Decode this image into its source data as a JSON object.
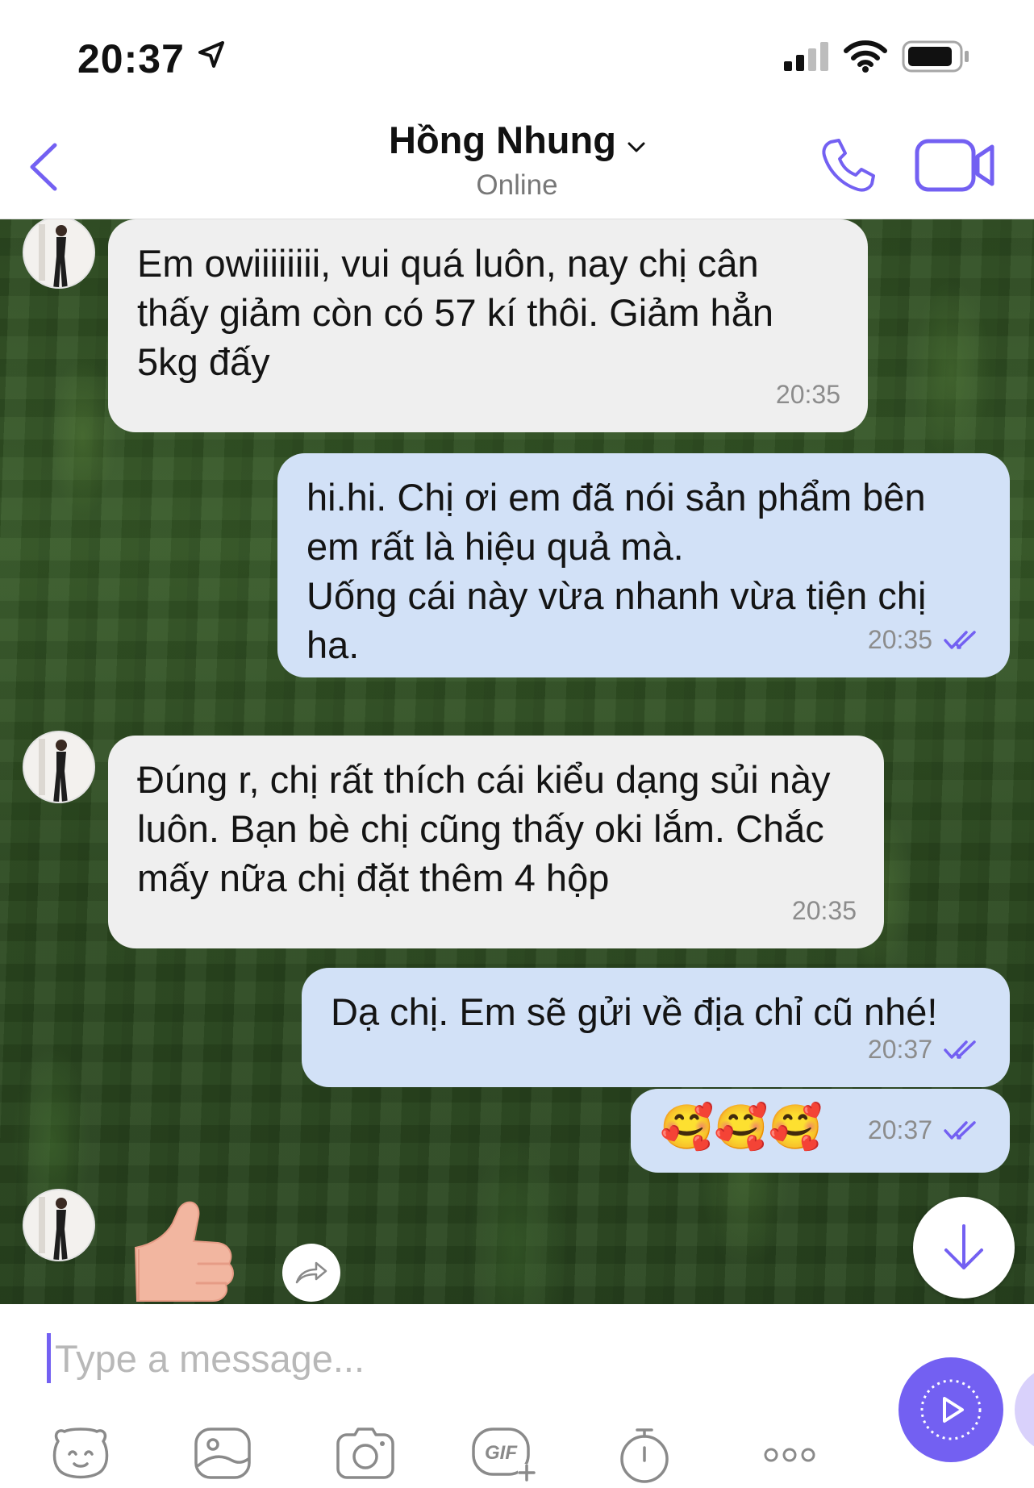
{
  "status_bar": {
    "time": "20:37"
  },
  "header": {
    "contact_name": "Hồng Nhung",
    "status": "Online"
  },
  "colors": {
    "accent": "#7360f2",
    "incoming_bubble": "#efefef",
    "outgoing_bubble": "#d2e1f7",
    "timestamp": "#8c8c8c"
  },
  "messages": [
    {
      "direction": "incoming",
      "text": "Em owiiiiiiii, vui quá luôn, nay chị cân thấy giảm còn có 57 kí thôi. Giảm hẳn 5kg đấy",
      "time": "20:35"
    },
    {
      "direction": "outgoing",
      "text": "hi.hi. Chị ơi em đã nói sản phẩm bên em rất là hiệu quả mà.\nUống cái này vừa nhanh vừa tiện chị ha.",
      "time": "20:35",
      "status_icon": "double-check-icon"
    },
    {
      "direction": "incoming",
      "text": "Đúng r, chị rất thích cái kiểu dạng sủi này luôn. Bạn bè chị cũng thấy oki lắm. Chắc mấy nữa chị đặt thêm 4 hộp",
      "time": "20:35"
    },
    {
      "direction": "outgoing",
      "text": "Dạ chị. Em sẽ gửi về địa chỉ cũ nhé!",
      "time": "20:37",
      "status_icon": "double-check-icon"
    },
    {
      "direction": "outgoing",
      "text": "🥰🥰🥰",
      "time": "20:37",
      "status_icon": "double-check-icon"
    }
  ],
  "sticker": {
    "name": "thumbs-up-sticker"
  },
  "composer": {
    "placeholder": "Type a message...",
    "tools": [
      "sticker-bear-icon",
      "gallery-icon",
      "camera-icon",
      "gif-icon",
      "timer-icon",
      "more-icon"
    ]
  }
}
